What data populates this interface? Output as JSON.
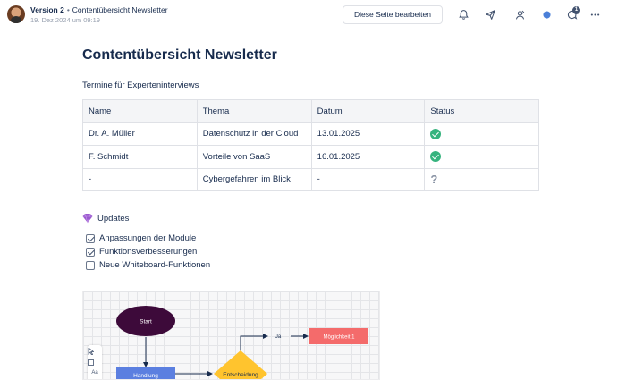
{
  "header": {
    "version": "Version 2",
    "separator": "•",
    "version_title": "Contentübersicht Newsletter",
    "date": "19. Dez 2024 um 09:19",
    "edit_button": "Diese Seite bearbeiten",
    "icons": [
      "bell-icon",
      "send-icon",
      "user-share-icon",
      "status-dot-icon",
      "comments-icon",
      "more-icon"
    ],
    "comment_count": "1",
    "status_color": "#4a7fd8"
  },
  "page": {
    "title": "Contentübersicht Newsletter",
    "section_heading": "Termine für Experteninterviews",
    "table": {
      "headers": [
        "Name",
        "Thema",
        "Datum",
        "Status"
      ],
      "rows": [
        {
          "name": "Dr. A. Müller",
          "topic": "Datenschutz in der Cloud",
          "date": "13.01.2025",
          "status": "done"
        },
        {
          "name": "F. Schmidt",
          "topic": "Vorteile von SaaS",
          "date": "16.01.2025",
          "status": "done"
        },
        {
          "name": "-",
          "topic": "Cybergefahren im Blick",
          "date": "-",
          "status": "?"
        }
      ]
    },
    "updates_heading": "Updates",
    "tasks": [
      {
        "label": "Anpassungen der Module",
        "checked": true
      },
      {
        "label": "Funktionsverbesserungen",
        "checked": true
      },
      {
        "label": "Neue Whiteboard-Funktionen",
        "checked": false
      }
    ]
  },
  "whiteboard": {
    "tools": [
      "Aa"
    ],
    "nodes": {
      "start": "Start",
      "action": "Handlung",
      "decision": "Entscheidung",
      "yes": "Ja",
      "option": "Möglichkeit 1"
    },
    "colors": {
      "start": "#3d0a3a",
      "action": "#5b7fe0",
      "decision": "#ffc42e",
      "option": "#f46b6b"
    }
  }
}
